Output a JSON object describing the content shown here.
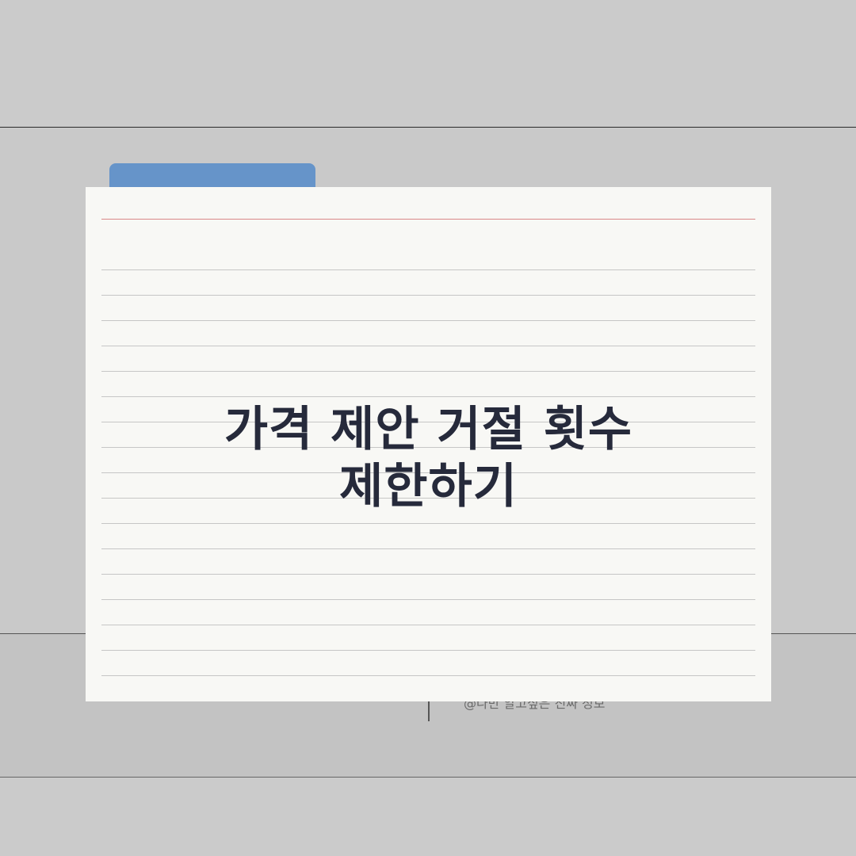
{
  "title": {
    "line1": "가격 제안 거절 횟수",
    "line2": "제한하기"
  },
  "footer": {
    "credit": "@나만 알고싶은 진짜 정보"
  },
  "colors": {
    "folder_tab": "#6694c9",
    "card": "#f8f8f5",
    "title_text": "#262a3b",
    "red_rule": "#d98888"
  }
}
